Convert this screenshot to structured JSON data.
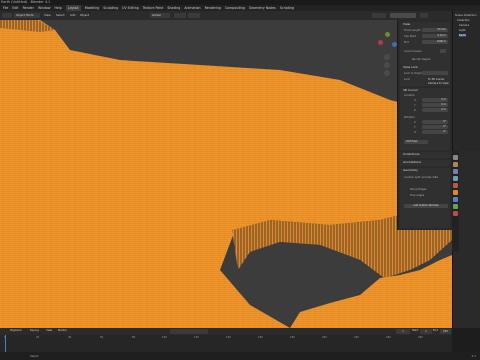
{
  "window": {
    "title": "Earth (Untitled) - Blender 4.1"
  },
  "menu": {
    "items": [
      "File",
      "Edit",
      "Render",
      "Window",
      "Help",
      "Layout",
      "Modeling",
      "Sculpting",
      "UV Editing",
      "Texture Paint",
      "Shading",
      "Animation",
      "Rendering",
      "Compositing",
      "Geometry Nodes",
      "Scripting"
    ]
  },
  "viewport": {
    "mode_label": "Object Mode",
    "menus": [
      "View",
      "Select",
      "Add",
      "Object"
    ],
    "transform_label": "Global",
    "mesh_color": "#f0962b",
    "bg_color": "#3c3c3c"
  },
  "npanel": {
    "tabs": [
      "Item",
      "Tool",
      "View"
    ],
    "view_section": "View",
    "focal_label": "Focal Length",
    "focal_value": "50 mm",
    "clip_start_label": "Clip Start",
    "clip_start_value": "0.01 m",
    "end_label": "End",
    "end_value": "1000 m",
    "local_camera_label": "Local Camera",
    "render_region_label": "Render Region",
    "view_lock_section": "View Lock",
    "lock_obj_label": "Lock to Object",
    "lock_label": "Lock",
    "lock_3d_cursor": "To 3D Cursor",
    "lock_camera": "Camera to View",
    "cursor_section": "3D Cursor",
    "location_label": "Location",
    "rotation_label": "Rotation",
    "x_label": "X",
    "y_label": "Y",
    "z_label": "Z",
    "loc_x": "0 m",
    "loc_y": "0 m",
    "loc_z": "0 m",
    "rot_x": "0°",
    "rot_y": "0°",
    "rot_z": "0°",
    "rotation_mode": "XYZ Euler",
    "collections_section": "Collections",
    "annotations_section": "Annotations",
    "geometry_section": "Geometry",
    "attrs_label": "Custom split normals data",
    "add_custom_normals": "Add Custom Normals",
    "sharp_edges": "Sharp Edges",
    "free_edges": "Free edges"
  },
  "outliner": {
    "items": [
      "Scene Collection",
      "Collection",
      "Camera",
      "Light",
      "Earth"
    ]
  },
  "timeline": {
    "header_items": [
      "Playback",
      "Keying",
      "View",
      "Marker"
    ],
    "ticks": [
      "0",
      "20",
      "40",
      "60",
      "80",
      "100",
      "120",
      "140",
      "160",
      "180",
      "200",
      "220",
      "240",
      "260"
    ],
    "current_frame": "1",
    "start_label": "Start",
    "start": "1",
    "end_label": "End",
    "end": "250"
  },
  "status": {
    "left": "Select",
    "right": "4.1"
  }
}
